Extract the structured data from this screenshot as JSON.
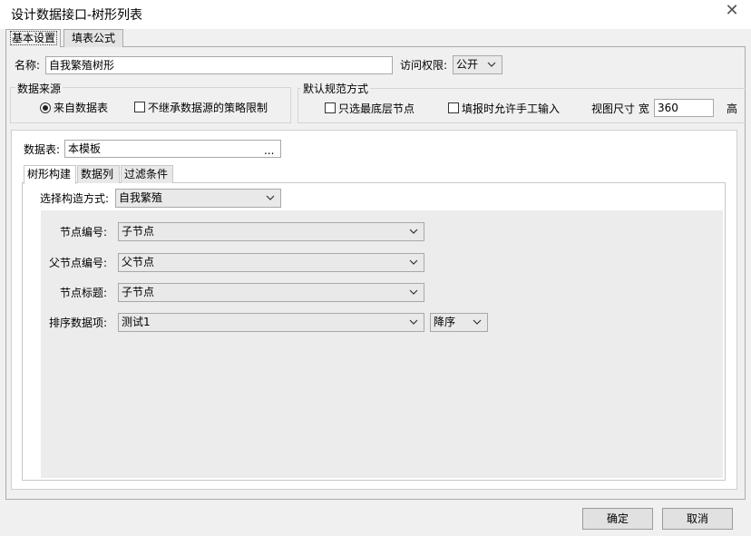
{
  "window": {
    "title": "设计数据接口-树形列表",
    "close_glyph": "✕"
  },
  "tabs": [
    {
      "label": "基本设置"
    },
    {
      "label": "填表公式"
    }
  ],
  "form": {
    "name_label": "名称:",
    "name_value": "自我繁殖树形",
    "access_label": "访问权限:",
    "access_value": "公开"
  },
  "data_source": {
    "title": "数据来源",
    "radio_label": "来自数据表",
    "checkbox_label": "不继承数据源的策略限制"
  },
  "default_mode": {
    "title": "默认规范方式",
    "only_leaf_label": "只选最底层节点",
    "manual_input_label": "填报时允许手工输入",
    "view_size_label": "视图尺寸 宽",
    "width_value": "360",
    "height_label": "高"
  },
  "data_table": {
    "label": "数据表:",
    "value": "本模板",
    "browse_label": "..."
  },
  "subtabs": [
    {
      "label": "树形构建"
    },
    {
      "label": "数据列"
    },
    {
      "label": "过滤条件"
    }
  ],
  "tree_build": {
    "method_label": "选择构造方式:",
    "method_value": "自我繁殖",
    "node_id_label": "节点编号:",
    "node_id_value": "子节点",
    "parent_id_label": "父节点编号:",
    "parent_id_value": "父节点",
    "node_title_label": "节点标题:",
    "node_title_value": "子节点",
    "sort_label": "排序数据项:",
    "sort_value": "测试1",
    "sort_order_value": "降序"
  },
  "buttons": {
    "ok": "确定",
    "cancel": "取消"
  }
}
